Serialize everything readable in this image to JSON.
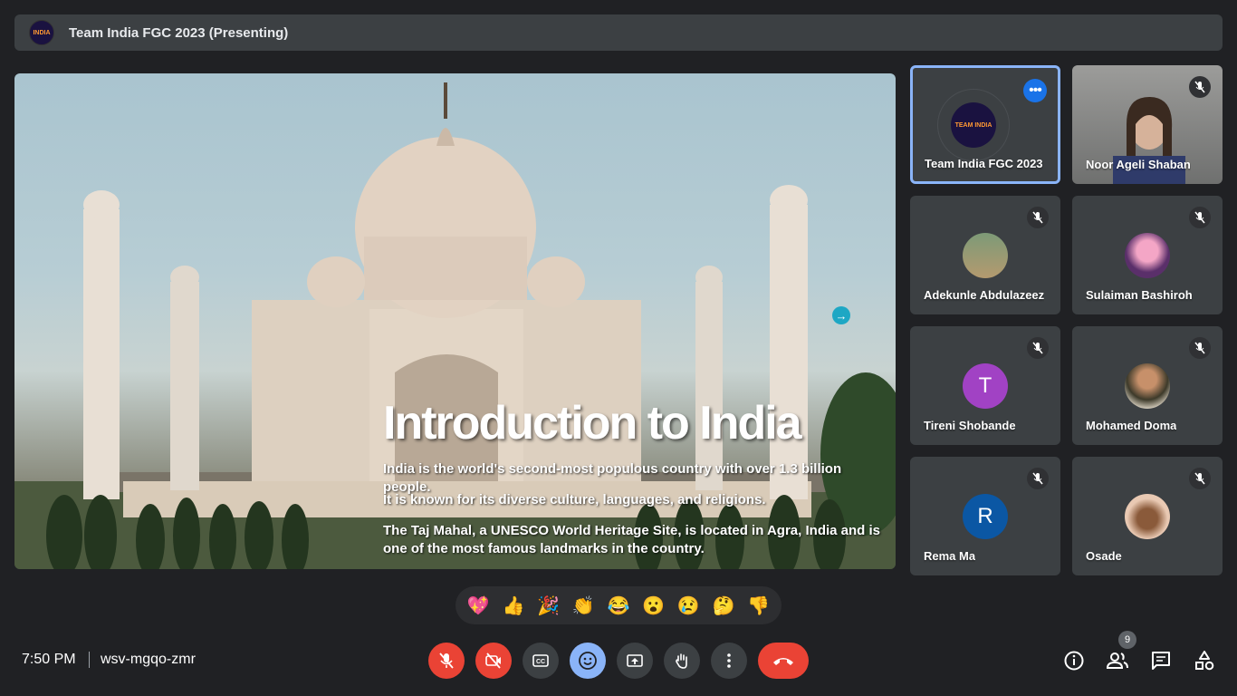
{
  "meeting": {
    "title": "Team India FGC 2023 (Presenting)",
    "logo_text": "INDIA",
    "time": "7:50 PM",
    "code": "wsv-mgqo-zmr"
  },
  "slide": {
    "title": "Introduction to India",
    "lines": [
      "India is the world's second-most populous country with over 1.3 billion people.",
      "It is known for its diverse culture, languages, and religions.",
      "The Taj Mahal, a UNESCO World Heritage Site, is located in Agra, India and is one of the most famous landmarks in the country."
    ],
    "arrow_icon": "→"
  },
  "participants": [
    {
      "name": "Team India FGC 2023",
      "initial": "",
      "logo": "TEAM INDIA",
      "color": "#1a1240"
    },
    {
      "name": "Noor Ageli Shaban",
      "initial": "",
      "color": "#8a8b8a"
    },
    {
      "name": "Adekunle Abdulazeez",
      "initial": "",
      "color": "#6e8f6a"
    },
    {
      "name": "Sulaiman Bashiroh",
      "initial": "",
      "color": "#5a2f6a"
    },
    {
      "name": "Tireni Shobande",
      "initial": "T",
      "color": "#a142c4"
    },
    {
      "name": "Mohamed Doma",
      "initial": "",
      "color": "#7a6a55"
    },
    {
      "name": "Rema Ma",
      "initial": "R",
      "color": "#0b57a4"
    },
    {
      "name": "Osade",
      "initial": "",
      "color": "#e9c9b3"
    }
  ],
  "reactions": [
    "💖",
    "👍",
    "🎉",
    "👏",
    "😂",
    "😮",
    "😢",
    "🤔",
    "👎"
  ],
  "people_count": "9",
  "colors": {
    "background": "#202124",
    "tile": "#3c4043",
    "danger": "#ea4335",
    "accent": "#8ab4f8"
  }
}
